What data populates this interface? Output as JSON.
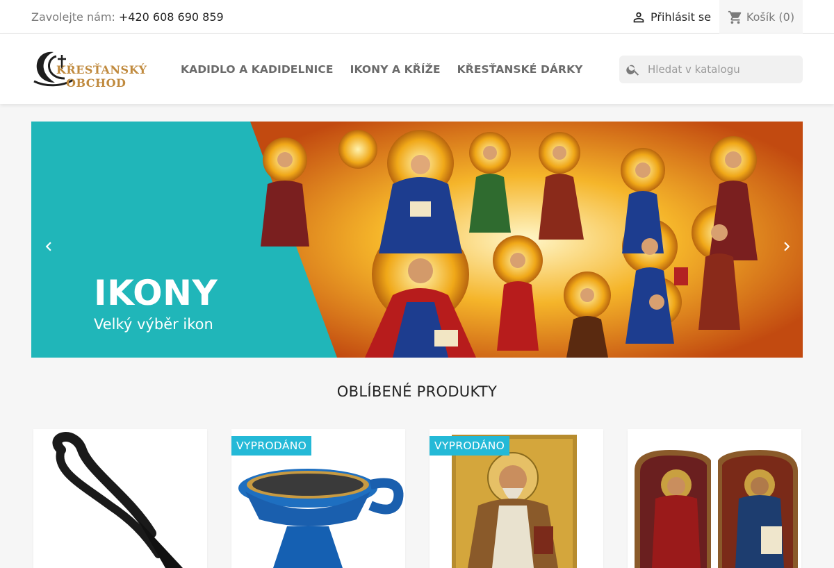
{
  "topbar": {
    "contact_label": "Zavolejte nám:",
    "phone": "+420 608 690 859",
    "signin_label": "Přihlásit se",
    "cart_label": "Košík",
    "cart_count": "(0)"
  },
  "header": {
    "logo_line1": "KŘESŤANSKÝ",
    "logo_line2": "OBCHOD",
    "nav": [
      {
        "label": "KADIDLO A KADIDELNICE"
      },
      {
        "label": "IKONY A KŘÍŽE"
      },
      {
        "label": "KŘESŤANSKÉ DÁRKY"
      }
    ],
    "search_placeholder": "Hledat v katalogu",
    "search_value": ""
  },
  "banner": {
    "title": "IKONY",
    "subtitle": "Velký výběr ikon",
    "accent_color": "#20b6b9"
  },
  "section": {
    "title": "OBLÍBENÉ PRODUKTY"
  },
  "products": [
    {
      "badge": ""
    },
    {
      "badge": "VYPRODÁNO"
    },
    {
      "badge": "VYPRODÁNO"
    },
    {
      "badge": ""
    }
  ],
  "colors": {
    "badge": "#24b9d7",
    "logo_gold": "#c08a3e"
  }
}
